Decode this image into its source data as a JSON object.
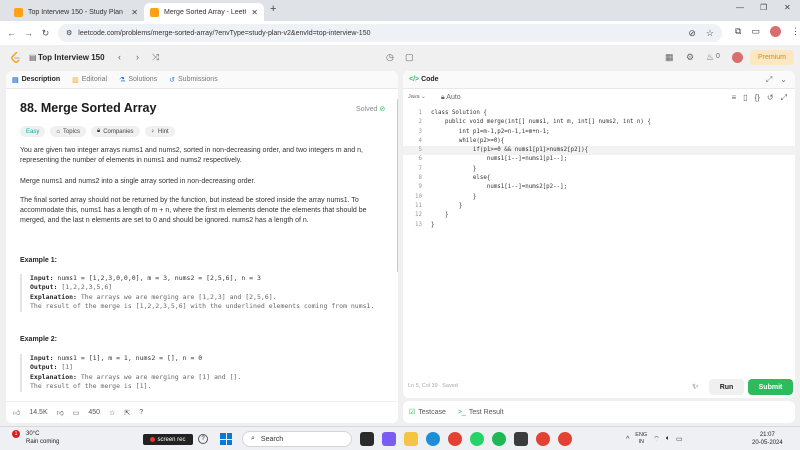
{
  "browser": {
    "tabs": [
      {
        "title": "Top Interview 150 - Study Plan",
        "active": false
      },
      {
        "title": "Merge Sorted Array - LeetCode",
        "active": true
      }
    ],
    "url": "leetcode.com/problems/merge-sorted-array/?envType=study-plan-v2&envId=top-interview-150"
  },
  "lc_header": {
    "plan": "Top Interview 150",
    "streak": "0",
    "premium_label": "Premium"
  },
  "left_tabs": [
    "Description",
    "Editorial",
    "Solutions",
    "Submissions"
  ],
  "problem": {
    "title": "88. Merge Sorted Array",
    "solved": "Solved",
    "chips": [
      "Easy",
      "Topics",
      "Companies",
      "Hint"
    ],
    "p1": "You are given two integer arrays nums1 and nums2, sorted in non-decreasing order, and two integers m and n, representing the number of elements in nums1 and nums2 respectively.",
    "p2": "Merge nums1 and nums2 into a single array sorted in non-decreasing order.",
    "p3": "The final sorted array should not be returned by the function, but instead be stored inside the array nums1. To accommodate this, nums1 has a length of m + n, where the first m elements denote the elements that should be merged, and the last n elements are set to 0 and should be ignored. nums2 has a length of n.",
    "examples": [
      {
        "title": "Example 1:",
        "input": "nums1 = [1,2,3,0,0,0], m = 3, nums2 = [2,5,6], n = 3",
        "output": "[1,2,2,3,5,6]",
        "explanation": "The arrays we are merging are [1,2,3] and [2,5,6].",
        "extra": "The result of the merge is [1,2,2,3,5,6] with the underlined elements coming from nums1."
      },
      {
        "title": "Example 2:",
        "input": "nums1 = [1], m = 1, nums2 = [], n = 0",
        "output": "[1]",
        "explanation": "The arrays we are merging are [1] and [].",
        "extra": "The result of the merge is [1]."
      }
    ],
    "labels": {
      "input": "Input:",
      "output": "Output:",
      "explanation": "Explanation:"
    }
  },
  "left_footer": {
    "likes": "14.5K",
    "comments": "450"
  },
  "code_panel": {
    "title": "Code",
    "language": "Java",
    "mode": "Auto",
    "lines": [
      "class Solution {",
      "    public void merge(int[] nums1, int m, int[] nums2, int n) {",
      "        int p1=m-1,p2=n-1,i=m+n-1;",
      "        while(p2>=0){",
      "            if(p1>=0 && nums1[p1]>nums2[p2]){",
      "                nums1[i--]=nums1[p1--];",
      "            }",
      "            else{",
      "                nums1[i--]=nums2[p2--];",
      "            }",
      "        }",
      "    }",
      "}"
    ],
    "status": "Ln 5, Col 39",
    "saved": "Saved",
    "run_label": "Run",
    "submit_label": "Submit"
  },
  "bottom_tabs": [
    "Testcase",
    "Test Result"
  ],
  "taskbar": {
    "weather_temp": "30°C",
    "weather_desc": "Rain coming",
    "notif_count": "1",
    "screenrec": "screen rec",
    "search": "Search",
    "lang_top": "ENG",
    "lang_bot": "IN",
    "time": "21:07",
    "date": "20-05-2024"
  }
}
